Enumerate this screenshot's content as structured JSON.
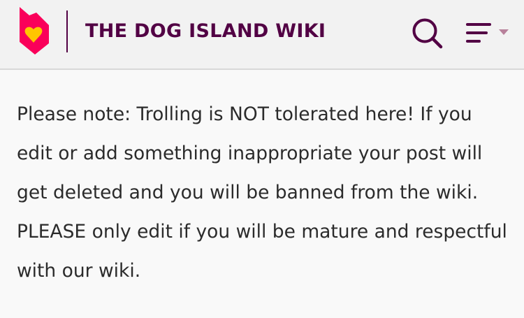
{
  "header": {
    "logo_icon": "fandom-heart-flame-logo",
    "title": "THE DOG ISLAND WIKI",
    "search_icon": "search-icon",
    "menu_icon": "hamburger-menu-icon",
    "colors": {
      "brand": "#520044",
      "logo_pink": "#fa005a",
      "logo_yellow": "#ffc500",
      "menu_caret": "#b8819b"
    }
  },
  "notice": {
    "text": "Please note: Trolling is NOT tolerated here! If you edit or add something inappropriate your post will get deleted and you will be banned from the wiki. PLEASE only edit if you will be mature and respectful with our wiki."
  }
}
